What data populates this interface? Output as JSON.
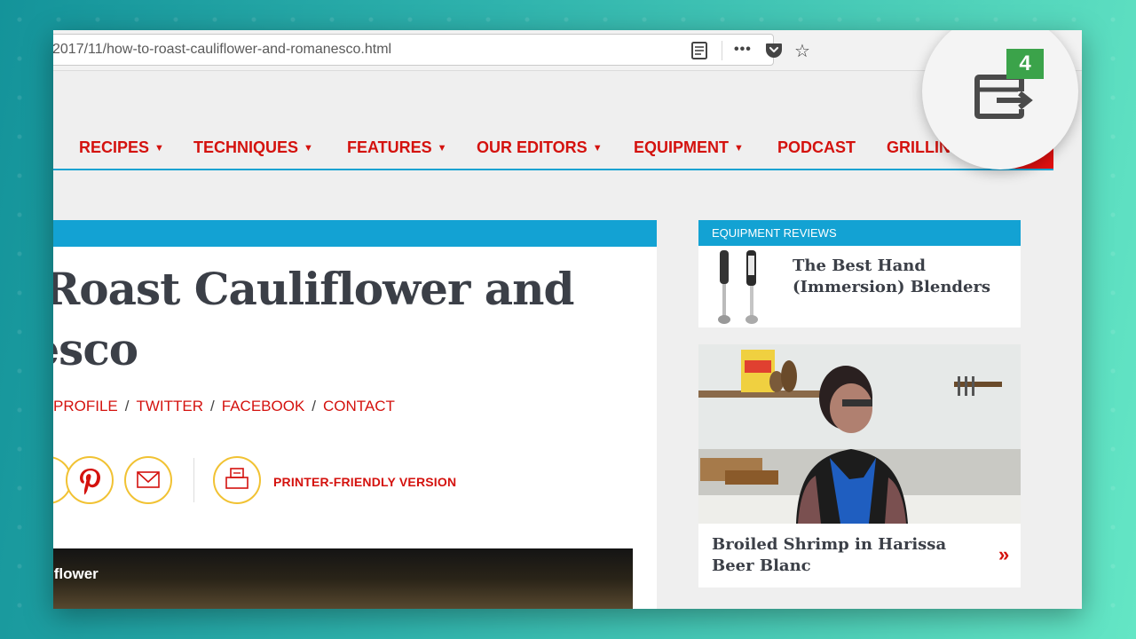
{
  "browser": {
    "url": "2017/11/how-to-roast-cauliflower-and-romanesco.html"
  },
  "nav": {
    "items": [
      {
        "label": "RECIPES",
        "caret": "▼"
      },
      {
        "label": "TECHNIQUES",
        "caret": "▼"
      },
      {
        "label": "FEATURES",
        "caret": "▼"
      },
      {
        "label": "OUR EDITORS",
        "caret": "▼"
      },
      {
        "label": "EQUIPMENT",
        "caret": "▼"
      },
      {
        "label": "PODCAST",
        "caret": ""
      },
      {
        "label": "GRILLIN",
        "caret": ""
      }
    ]
  },
  "article": {
    "headline_line1": "o Roast Cauliflower and",
    "headline_line2": "nesco",
    "byline": [
      "PROFILE",
      "TWITTER",
      "FACEBOOK",
      "CONTACT"
    ],
    "byline_sep": "/",
    "printer_label": "PRINTER-FRIENDLY VERSION",
    "photo_caption": "iflower"
  },
  "sidebar": {
    "reviews_header": "EQUIPMENT REVIEWS",
    "reviews_title": "The Best Hand (Immersion) Blenders",
    "video_title": "Broiled Shrimp in Harissa Beer Blanc",
    "video_arrow": "»"
  },
  "extension": {
    "badge_count": "4",
    "colors": {
      "badge": "#3ba34a",
      "icon": "#4a4a4a"
    }
  },
  "colors": {
    "brand_red": "#d4120e",
    "accent_blue": "#13a2d3",
    "share_ring": "#f1c233"
  }
}
